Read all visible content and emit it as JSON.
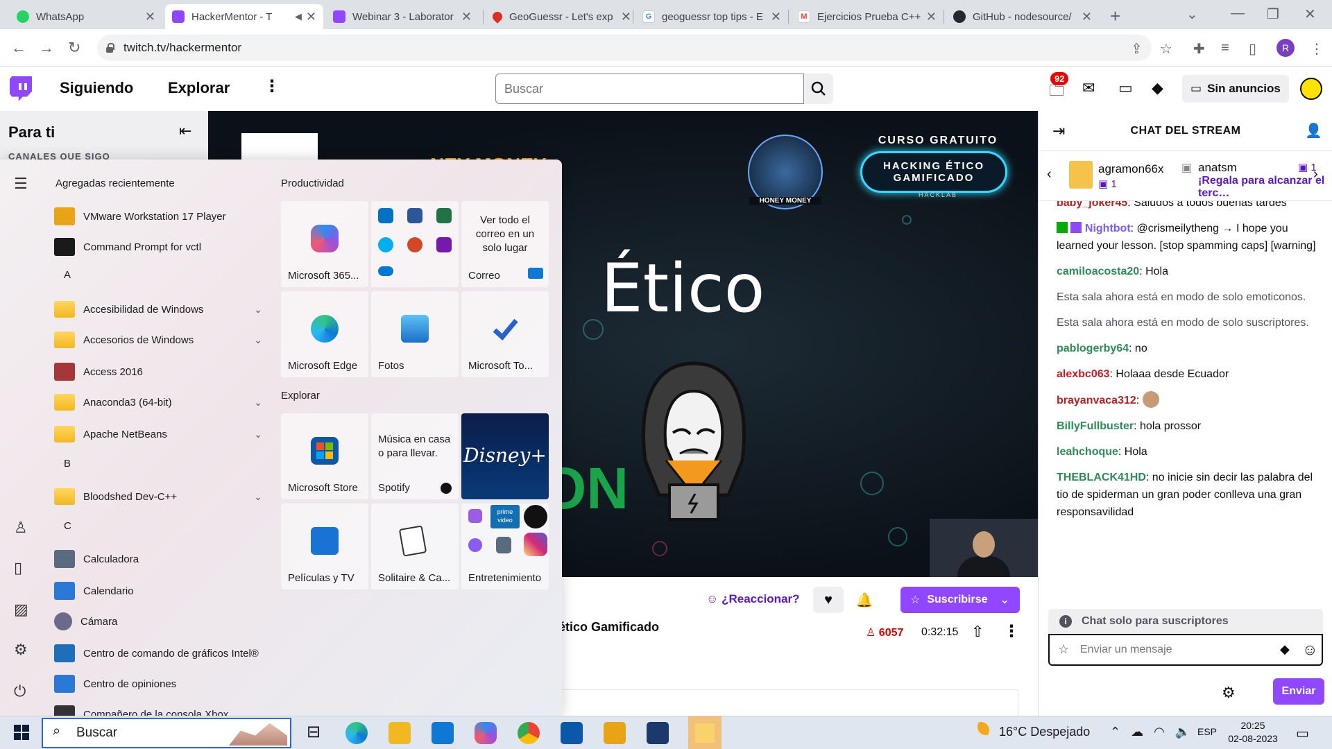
{
  "browser": {
    "tabs": [
      {
        "title": "WhatsApp",
        "color": "#25d366"
      },
      {
        "title": "HackerMentor - T",
        "color": "#9146ff"
      },
      {
        "title": "Webinar 3 - Laborator",
        "color": "#9146ff"
      },
      {
        "title": "GeoGuessr - Let's exp",
        "color": "#d93025"
      },
      {
        "title": "geoguessr top tips - E",
        "color": "#4285f4"
      },
      {
        "title": "Ejercicios Prueba C++",
        "color": "#ea4335"
      },
      {
        "title": "GitHub - nodesource/",
        "color": "#24292f"
      }
    ],
    "url": "twitch.tv/hackermentor",
    "profile_initial": "R"
  },
  "twitch_nav": {
    "following": "Siguiendo",
    "browse": "Explorar",
    "search_placeholder": "Buscar",
    "notifications_count": "92",
    "ad_free": "Sin anuncios"
  },
  "sidebar": {
    "for_you": "Para ti",
    "followed_channels": "CANALES QUE SIGO"
  },
  "video": {
    "course_free": "CURSO GRATUITO",
    "badge_line1": "HACKING ÉTICO",
    "badge_line2": "GAMIFICADO",
    "badge_sub": "HACKLAB",
    "honey_money_text": "NEY MONEY",
    "honey_logo_label": "HONEY MONEY",
    "big_word": "Ético",
    "green_text": "ON"
  },
  "below_video": {
    "react": "¿Reaccionar?",
    "subscribe": "Suscribirse",
    "title_fragment": "ng ético Gamificado",
    "viewers": "6057",
    "uptime": "0:32:15"
  },
  "chat": {
    "title": "CHAT DEL STREAM",
    "gift1_user": "agramon66x",
    "gift1_count": "1",
    "gift2_user": "anatsm",
    "gift2_count": "1",
    "gift2_message": "¡Regala para alcanzar el terc…",
    "messages": [
      {
        "user": "baby_joker45",
        "color": "#b22222",
        "text": "Saludos a todos buenas tardes"
      },
      {
        "user": "Nightbot",
        "color": "#7c5cff",
        "text": "@crismeilytheng → I hope you learned your lesson. [stop spamming caps] [warning]"
      },
      {
        "user": "camiloacosta20",
        "color": "#2e8b57",
        "text": "Hola"
      },
      {
        "user": "",
        "color": "#53535f",
        "text": "Esta sala ahora está en modo de solo emoticonos."
      },
      {
        "user": "",
        "color": "#53535f",
        "text": "Esta sala ahora está en modo de solo suscriptores."
      },
      {
        "user": "pablogerby64",
        "color": "#2e8b57",
        "text": "no"
      },
      {
        "user": "alexbc063",
        "color": "#c81d25",
        "text": "Holaaa desde Ecuador"
      },
      {
        "user": "brayanvaca312",
        "color": "#b22222",
        "text": ""
      },
      {
        "user": "BillyFullbuster",
        "color": "#2e8b57",
        "text": "hola prossor"
      },
      {
        "user": "leahchoque",
        "color": "#2e8b57",
        "text": "Hola"
      },
      {
        "user": "THEBLACK41HD",
        "color": "#2e8b57",
        "text": "no inicie sin decir las palabra del tio de spiderman un gran poder conlleva una gran responsavilidad"
      }
    ],
    "sub_only": "Chat solo para suscriptores",
    "input_placeholder": "Enviar un mensaje",
    "send": "Enviar"
  },
  "start_menu": {
    "recent_header": "Agregadas recientemente",
    "productivity_header": "Productividad",
    "explore_header": "Explorar",
    "apps": [
      {
        "label": "VMware Workstation 17 Player",
        "icon": "vmware-icon",
        "color": "#e8a317",
        "expand": false
      },
      {
        "label": "Command Prompt for vctl",
        "icon": "terminal-icon",
        "color": "#1a1a1a",
        "expand": false
      },
      {
        "label": "A",
        "letter": true
      },
      {
        "label": "Accesibilidad de Windows",
        "icon": "folder-icon",
        "folder": true,
        "expand": true
      },
      {
        "label": "Accesorios de Windows",
        "icon": "folder-icon",
        "folder": true,
        "expand": true
      },
      {
        "label": "Access 2016",
        "icon": "access-icon",
        "color": "#a4373a",
        "expand": false
      },
      {
        "label": "Anaconda3 (64-bit)",
        "icon": "folder-icon",
        "folder": true,
        "expand": true
      },
      {
        "label": "Apache NetBeans",
        "icon": "folder-icon",
        "folder": true,
        "expand": true
      },
      {
        "label": "B",
        "letter": true
      },
      {
        "label": "Bloodshed Dev-C++",
        "icon": "folder-icon",
        "folder": true,
        "expand": true
      },
      {
        "label": "C",
        "letter": true
      },
      {
        "label": "Calculadora",
        "icon": "calculator-icon",
        "color": "#5b6b7f",
        "expand": false
      },
      {
        "label": "Calendario",
        "icon": "calendar-icon",
        "color": "#2a79d6",
        "expand": false
      },
      {
        "label": "Cámara",
        "icon": "camera-icon",
        "color": "#6a6a8a",
        "expand": false
      },
      {
        "label": "Centro de comando de gráficos Intel®",
        "icon": "intel-icon",
        "color": "#1f6fb8",
        "expand": false
      },
      {
        "label": "Centro de opiniones",
        "icon": "feedback-icon",
        "color": "#2a79d6",
        "expand": false
      },
      {
        "label": "Compañero de la consola Xbox",
        "icon": "xbox-icon",
        "color": "#333",
        "expand": false
      }
    ],
    "tiles": {
      "m365": "Microsoft 365...",
      "mail_text": "Ver todo el correo en un solo lugar",
      "mail": "Correo",
      "edge": "Microsoft Edge",
      "photos": "Fotos",
      "todo": "Microsoft To...",
      "store": "Microsoft Store",
      "spotify_text": "Música en casa o para llevar.",
      "spotify": "Spotify",
      "disney": "Disney+",
      "movies": "Películas y TV",
      "solitaire": "Solitaire & Ca...",
      "entertainment": "Entretenimiento",
      "prime": "prime video"
    }
  },
  "taskbar": {
    "search": "Buscar",
    "weather": "16°C  Despejado",
    "lang": "ESP",
    "time": "20:25",
    "date": "02-08-2023"
  }
}
